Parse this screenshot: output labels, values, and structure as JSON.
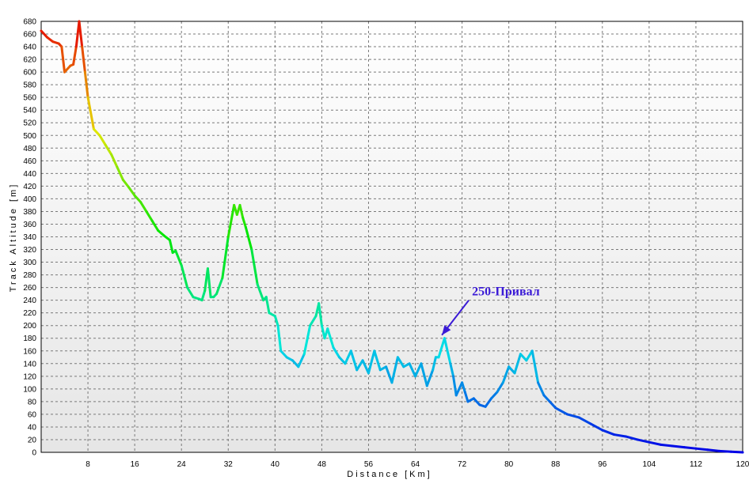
{
  "chart_data": {
    "type": "line",
    "xlabel": "Distance  [Km]",
    "ylabel": "Track  Altitude  [m]",
    "xlim": [
      0,
      120
    ],
    "ylim": [
      0,
      680
    ],
    "x_ticks": [
      8,
      16,
      24,
      32,
      40,
      48,
      56,
      64,
      72,
      80,
      88,
      96,
      104,
      112,
      120
    ],
    "y_ticks": [
      0,
      20,
      40,
      60,
      80,
      100,
      120,
      140,
      160,
      180,
      200,
      220,
      240,
      260,
      280,
      300,
      320,
      340,
      360,
      380,
      400,
      420,
      440,
      460,
      480,
      500,
      520,
      540,
      560,
      580,
      600,
      620,
      640,
      660,
      680
    ],
    "grid": true,
    "series": [
      {
        "x": [
          0,
          1,
          2,
          3,
          3.5,
          4,
          5,
          5.5,
          6,
          6.5,
          7,
          7.5,
          8,
          9,
          10,
          11,
          12,
          13,
          14,
          15,
          16,
          17,
          18,
          19,
          20,
          21,
          22,
          22.5,
          23,
          24,
          25,
          26,
          27,
          27.5,
          28,
          28.5,
          29,
          29.5,
          30,
          31,
          32,
          33,
          33.5,
          34,
          34.5,
          35,
          36,
          37,
          38,
          38.5,
          39,
          40,
          40.5,
          41,
          42,
          43,
          44,
          45,
          46,
          47,
          47.5,
          48,
          48.5,
          49,
          50,
          51,
          52,
          53,
          54,
          55,
          56,
          57,
          58,
          59,
          60,
          61,
          62,
          63,
          64,
          65,
          66,
          67,
          67.5,
          68,
          69,
          70,
          70.5,
          71,
          72,
          72.5,
          73,
          74,
          75,
          76,
          77,
          78,
          79,
          80,
          81,
          82,
          83,
          84,
          85,
          86,
          87,
          88,
          90,
          92,
          94,
          96,
          98,
          100,
          102,
          104,
          106,
          108,
          110,
          112,
          114,
          116,
          118,
          120
        ],
        "y": [
          665,
          655,
          648,
          645,
          640,
          600,
          610,
          612,
          640,
          680,
          640,
          600,
          560,
          510,
          500,
          485,
          470,
          450,
          430,
          418,
          405,
          395,
          380,
          365,
          350,
          342,
          335,
          315,
          318,
          295,
          260,
          245,
          242,
          240,
          255,
          290,
          245,
          245,
          250,
          275,
          340,
          390,
          375,
          390,
          370,
          355,
          320,
          265,
          240,
          245,
          220,
          215,
          200,
          160,
          150,
          145,
          135,
          155,
          200,
          215,
          235,
          200,
          180,
          195,
          165,
          150,
          140,
          160,
          130,
          145,
          125,
          160,
          130,
          135,
          110,
          150,
          135,
          140,
          120,
          140,
          105,
          130,
          150,
          150,
          180,
          140,
          120,
          90,
          110,
          95,
          80,
          85,
          75,
          72,
          85,
          95,
          110,
          135,
          125,
          155,
          145,
          160,
          110,
          90,
          80,
          70,
          60,
          55,
          45,
          35,
          28,
          25,
          20,
          16,
          12,
          10,
          8,
          6,
          4,
          2,
          1,
          0
        ]
      }
    ],
    "annotations": [
      {
        "text": "250-Привал",
        "x": 68,
        "y": 180
      }
    ]
  }
}
